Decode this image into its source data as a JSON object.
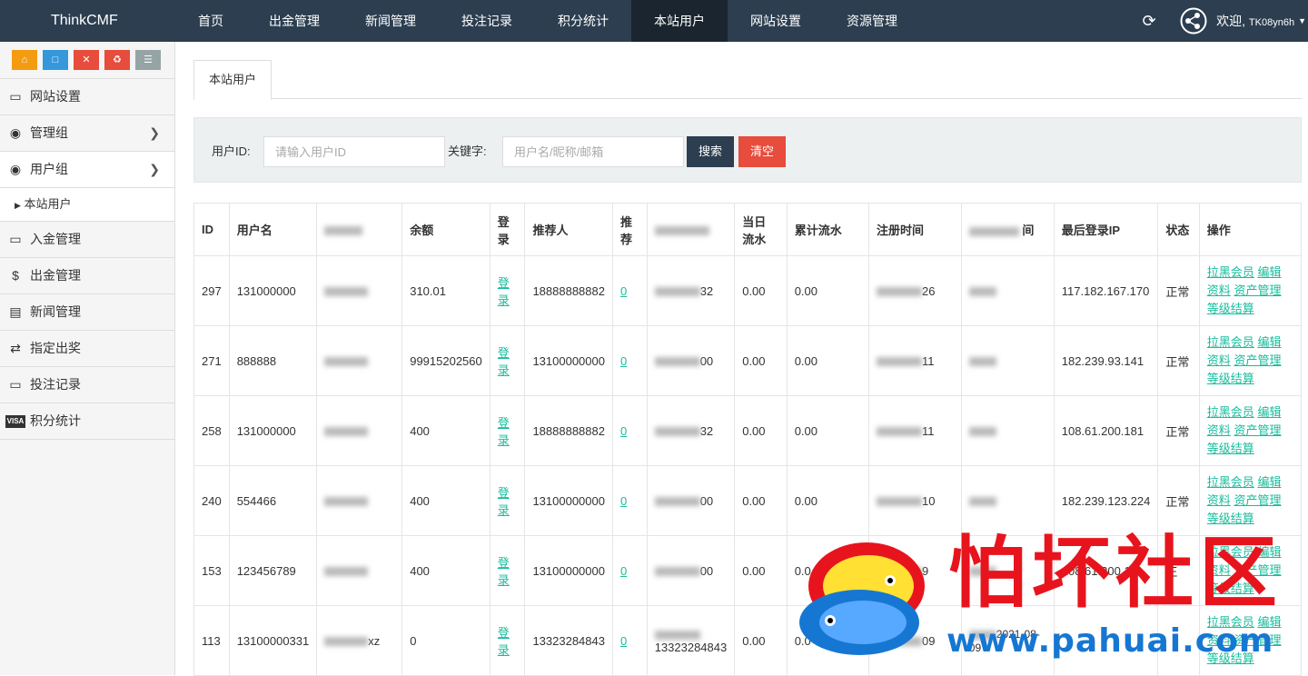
{
  "header": {
    "brand": "ThinkCMF",
    "nav": [
      "首页",
      "出金管理",
      "新闻管理",
      "投注记录",
      "积分统计",
      "本站用户",
      "网站设置",
      "资源管理"
    ],
    "active_nav": "本站用户",
    "welcome": "欢迎,",
    "username": "TK08yn6h"
  },
  "sidebar": {
    "shortcuts": [
      "home-icon",
      "file-icon",
      "trash-icon",
      "recycle-icon",
      "list-icon"
    ],
    "items": [
      {
        "label": "网站设置",
        "icon": "monitor-icon",
        "has_arrow": false
      },
      {
        "label": "管理组",
        "icon": "user-circle-icon",
        "has_arrow": true
      },
      {
        "label": "用户组",
        "icon": "user-circle-icon",
        "has_arrow": true
      },
      {
        "label": "本站用户",
        "sub": true
      },
      {
        "label": "入金管理",
        "icon": "monitor-icon",
        "has_arrow": false
      },
      {
        "label": "出金管理",
        "icon": "dollar-icon",
        "has_arrow": false
      },
      {
        "label": "新闻管理",
        "icon": "newspaper-icon",
        "has_arrow": false
      },
      {
        "label": "指定出奖",
        "icon": "exchange-icon",
        "has_arrow": false
      },
      {
        "label": "投注记录",
        "icon": "monitor-icon",
        "has_arrow": false
      },
      {
        "label": "积分统计",
        "icon": "visa-icon",
        "has_arrow": false
      }
    ]
  },
  "tab": "本站用户",
  "search": {
    "userid_label": "用户ID:",
    "userid_placeholder": "请输入用户ID",
    "keyword_label": "关键字:",
    "keyword_placeholder": "用户名/昵称/邮箱",
    "search_button": "搜索",
    "clear_button": "清空"
  },
  "table": {
    "headers": {
      "id": "ID",
      "username": "用户名",
      "balance": "余额",
      "login": "登录",
      "referrer": "推荐人",
      "referrer_count": "推\n荐",
      "daily_flow": "当日\n流水",
      "total_flow": "累计流水",
      "reg_time": "注册时间",
      "last_login_time": "间",
      "last_ip": "最后登录IP",
      "status": "状态",
      "ops": "操作"
    },
    "ops_links": [
      "拉黑会员",
      "编辑",
      "资料",
      "资产管理",
      "等级结算"
    ],
    "login_text": "登\n录",
    "rows": [
      {
        "id": "297",
        "username": "131000000",
        "balance": "310.01",
        "referrer": "18888888882",
        "refcount": "0",
        "refcount2": "32",
        "daily": "0.00",
        "total": "0.00",
        "reg_tail": "26",
        "ip": "117.182.167.170",
        "status": "正常"
      },
      {
        "id": "271",
        "username": "888888",
        "balance": "99915202560",
        "referrer": "13100000000",
        "refcount": "0",
        "refcount2": "00",
        "daily": "0.00",
        "total": "0.00",
        "reg_tail": "11",
        "ip": "182.239.93.141",
        "status": "正常"
      },
      {
        "id": "258",
        "username": "131000000",
        "balance": "400",
        "referrer": "18888888882",
        "refcount": "0",
        "refcount2": "32",
        "daily": "0.00",
        "total": "0.00",
        "reg_tail": "11",
        "ip": "108.61.200.181",
        "status": "正常"
      },
      {
        "id": "240",
        "username": "554466",
        "balance": "400",
        "referrer": "13100000000",
        "refcount": "0",
        "refcount2": "00",
        "daily": "0.00",
        "total": "0.00",
        "reg_tail": "10",
        "ip": "182.239.123.224",
        "status": "正常"
      },
      {
        "id": "153",
        "username": "123456789",
        "balance": "400",
        "referrer": "13100000000",
        "refcount": "0",
        "refcount2": "00",
        "daily": "0.00",
        "total": "0.0",
        "reg_tail": "9",
        "ip": "108.61.200.18",
        "status": "正"
      },
      {
        "id": "113",
        "username": "13100000331",
        "nickname": "xz",
        "balance": "0",
        "referrer": "13323284843",
        "refcount": "0",
        "refcount2": "13323284843",
        "daily": "0.00",
        "total": "0.0",
        "reg_tail": "09",
        "reg2": "2021-08-09",
        "ip": "",
        "status": ""
      }
    ]
  },
  "watermark": {
    "text": "怕坏社区",
    "url": "www.pahuai.com"
  }
}
